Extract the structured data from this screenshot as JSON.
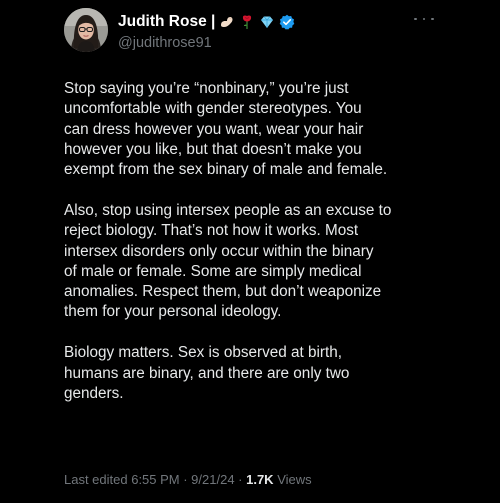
{
  "author": {
    "display_name": "Judith Rose |",
    "handle": "@judithrose91",
    "name_emojis": [
      "arm-icon",
      "rose-icon",
      "diamond-icon"
    ],
    "verified": true,
    "verified_color": "#1d9bf0"
  },
  "tweet": {
    "paragraphs": [
      "Stop saying you’re “nonbinary,” you’re just\nuncomfortable with gender stereotypes. You\ncan dress however you want, wear your hair\nhowever you like, but that doesn’t make you\nexempt from the sex binary of male and female.",
      "Also, stop using intersex people as an excuse to\nreject biology. That’s not how it works. Most\nintersex disorders only occur within the binary\nof male or female. Some are simply medical\nanomalies. Respect them, but don’t weaponize\nthem for your personal ideology.",
      "Biology matters. Sex is observed at birth,\nhumans are binary, and there are only two\ngenders."
    ]
  },
  "meta": {
    "edited_label": "Last edited 6:55 PM · 9/21/24 · ",
    "views_count": "1.7K",
    "views_label": " Views"
  },
  "colors": {
    "background": "#000000",
    "text": "#e7e9ea",
    "muted": "#71767b"
  }
}
